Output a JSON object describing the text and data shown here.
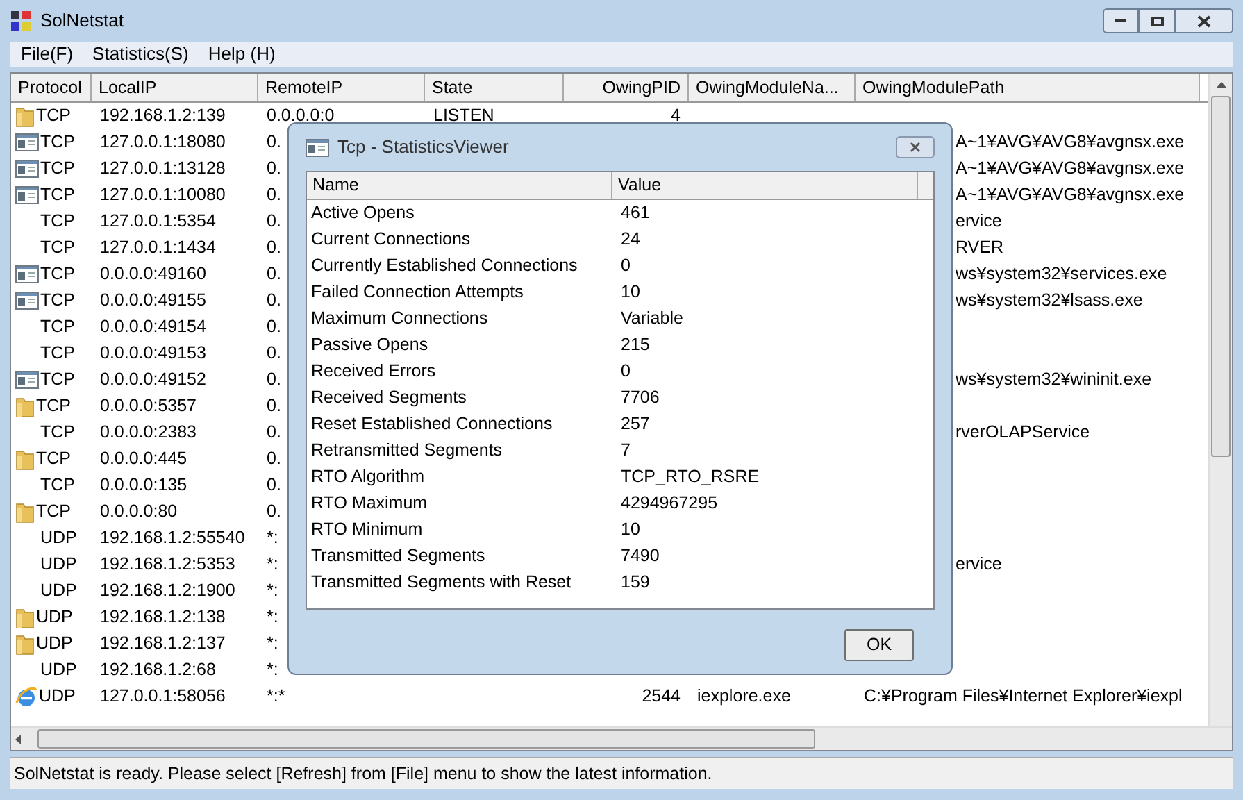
{
  "window": {
    "title": "SolNetstat"
  },
  "menu": [
    "File(F)",
    "Statistics(S)",
    "Help (H)"
  ],
  "table": {
    "columns": [
      "Protocol",
      "LocalIP",
      "RemoteIP",
      "State",
      "OwingPID",
      "OwingModuleNa...",
      "OwingModulePath"
    ],
    "rows": [
      {
        "kind": "folder",
        "protocol": "TCP",
        "local": "192.168.1.2:139",
        "remote": "0.0.0.0:0",
        "state": "LISTEN",
        "pid": "4"
      },
      {
        "kind": "window",
        "protocol": "TCP",
        "local": "127.0.0.1:18080",
        "remote": "0.",
        "path": "A~1¥AVG¥AVG8¥avgnsx.exe"
      },
      {
        "kind": "window",
        "protocol": "TCP",
        "local": "127.0.0.1:13128",
        "remote": "0.",
        "path": "A~1¥AVG¥AVG8¥avgnsx.exe"
      },
      {
        "kind": "window",
        "protocol": "TCP",
        "local": "127.0.0.1:10080",
        "remote": "0.",
        "path": "A~1¥AVG¥AVG8¥avgnsx.exe"
      },
      {
        "kind": "none",
        "protocol": "TCP",
        "local": "127.0.0.1:5354",
        "remote": "0.",
        "path": "ervice"
      },
      {
        "kind": "none",
        "protocol": "TCP",
        "local": "127.0.0.1:1434",
        "remote": "0.",
        "path": "RVER"
      },
      {
        "kind": "window",
        "protocol": "TCP",
        "local": "0.0.0.0:49160",
        "remote": "0.",
        "path": "ws¥system32¥services.exe"
      },
      {
        "kind": "window",
        "protocol": "TCP",
        "local": "0.0.0.0:49155",
        "remote": "0.",
        "path": "ws¥system32¥lsass.exe"
      },
      {
        "kind": "none",
        "protocol": "TCP",
        "local": "0.0.0.0:49154",
        "remote": "0."
      },
      {
        "kind": "none",
        "protocol": "TCP",
        "local": "0.0.0.0:49153",
        "remote": "0."
      },
      {
        "kind": "window",
        "protocol": "TCP",
        "local": "0.0.0.0:49152",
        "remote": "0.",
        "path": "ws¥system32¥wininit.exe"
      },
      {
        "kind": "folder",
        "protocol": "TCP",
        "local": "0.0.0.0:5357",
        "remote": "0."
      },
      {
        "kind": "none",
        "protocol": "TCP",
        "local": "0.0.0.0:2383",
        "remote": "0.",
        "path": "rverOLAPService"
      },
      {
        "kind": "folder",
        "protocol": "TCP",
        "local": "0.0.0.0:445",
        "remote": "0."
      },
      {
        "kind": "none",
        "protocol": "TCP",
        "local": "0.0.0.0:135",
        "remote": "0."
      },
      {
        "kind": "folder",
        "protocol": "TCP",
        "local": "0.0.0.0:80",
        "remote": "0."
      },
      {
        "kind": "none",
        "protocol": "UDP",
        "local": "192.168.1.2:55540",
        "remote": "*:"
      },
      {
        "kind": "none",
        "protocol": "UDP",
        "local": "192.168.1.2:5353",
        "remote": "*:",
        "path": "ervice"
      },
      {
        "kind": "none",
        "protocol": "UDP",
        "local": "192.168.1.2:1900",
        "remote": "*:"
      },
      {
        "kind": "folder",
        "protocol": "UDP",
        "local": "192.168.1.2:138",
        "remote": "*:"
      },
      {
        "kind": "folder",
        "protocol": "UDP",
        "local": "192.168.1.2:137",
        "remote": "*:"
      },
      {
        "kind": "none",
        "protocol": "UDP",
        "local": "192.168.1.2:68",
        "remote": "*:"
      },
      {
        "kind": "browser",
        "protocol": "UDP",
        "local": "127.0.0.1:58056",
        "remote": "*:*",
        "pid": "2544",
        "module": "iexplore.exe",
        "path": "C:¥Program Files¥Internet Explorer¥iexpl"
      }
    ]
  },
  "dialog": {
    "title": "Tcp - StatisticsViewer",
    "columns": [
      "Name",
      "Value"
    ],
    "rows": [
      {
        "name": "Active Opens",
        "value": "461"
      },
      {
        "name": "Current Connections",
        "value": "24"
      },
      {
        "name": "Currently Established Connections",
        "value": "0"
      },
      {
        "name": "Failed Connection Attempts",
        "value": "10"
      },
      {
        "name": "Maximum Connections",
        "value": "Variable"
      },
      {
        "name": "Passive Opens",
        "value": "215"
      },
      {
        "name": "Received Errors",
        "value": "0"
      },
      {
        "name": "Received Segments",
        "value": "7706"
      },
      {
        "name": "Reset Established Connections",
        "value": "257"
      },
      {
        "name": "Retransmitted Segments",
        "value": "7"
      },
      {
        "name": "RTO Algorithm",
        "value": "TCP_RTO_RSRE"
      },
      {
        "name": "RTO Maximum",
        "value": "4294967295"
      },
      {
        "name": "RTO Minimum",
        "value": "10"
      },
      {
        "name": "Transmitted Segments",
        "value": "7490"
      },
      {
        "name": "Transmitted Segments with Reset",
        "value": "159"
      }
    ],
    "button": "OK"
  },
  "status_bar": "SolNetstat is ready. Please select [Refresh] from [File] menu to show the latest information."
}
